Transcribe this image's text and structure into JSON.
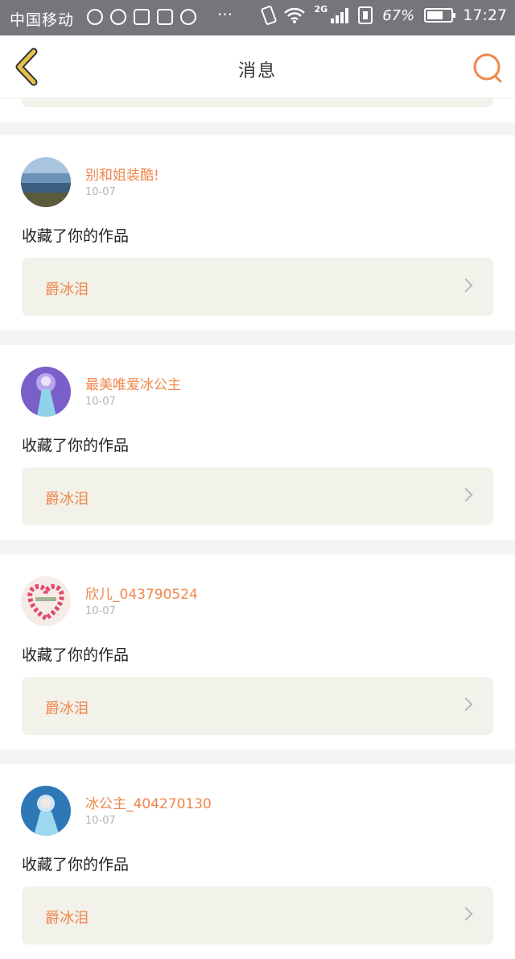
{
  "status_bar": {
    "carrier": "中国移动",
    "network": "2G",
    "battery_percent": "67%",
    "battery_level": 0.67,
    "time": "17:27"
  },
  "header": {
    "title": "消息",
    "back_icon": "chevron-left-icon",
    "search_icon": "search-icon"
  },
  "messages": [
    {
      "username": "别和姐装酷!",
      "date": "10-07",
      "action": "收藏了你的作品",
      "work_title": "爵冰泪",
      "avatar": "seaside-photo"
    },
    {
      "username": "最美唯爱冰公主",
      "date": "10-07",
      "action": "收藏了你的作品",
      "work_title": "爵冰泪",
      "avatar": "ice-princess-art"
    },
    {
      "username": "欣儿_043790524",
      "date": "10-07",
      "action": "收藏了你的作品",
      "work_title": "爵冰泪",
      "avatar": "heart-flowers"
    },
    {
      "username": "冰公主_404270130",
      "date": "10-07",
      "action": "收藏了你的作品",
      "work_title": "爵冰泪",
      "avatar": "ice-princess-art-2"
    }
  ],
  "colors": {
    "accent": "#f0874b",
    "status_bar": "#75757b",
    "back_icon": "#e6c24f",
    "card_link_bg": "#f2f1ea"
  }
}
